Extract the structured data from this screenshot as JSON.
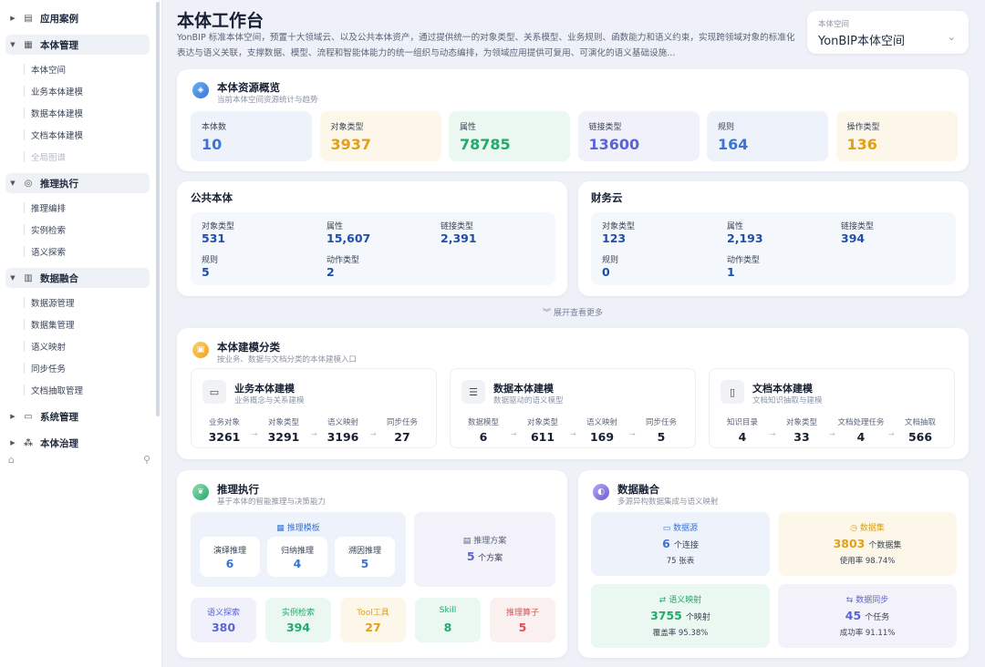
{
  "sidebar": {
    "groups": [
      {
        "label": "应用案例",
        "icon": "apps-icon"
      },
      {
        "label": "本体管理",
        "icon": "ontology-icon"
      },
      {
        "label": "推理执行",
        "icon": "target-icon"
      },
      {
        "label": "数据融合",
        "icon": "bar-chart-icon"
      },
      {
        "label": "系统管理",
        "icon": "monitor-icon"
      },
      {
        "label": "本体治理",
        "icon": "nodes-icon"
      }
    ],
    "ontology_items": [
      "本体空间",
      "业务本体建模",
      "数据本体建模",
      "文档本体建模",
      "全局图谱"
    ],
    "reasoning_items": [
      "推理编排",
      "实例检索",
      "语义探索"
    ],
    "fusion_items": [
      "数据源管理",
      "数据集管理",
      "语义映射",
      "同步任务",
      "文档抽取管理"
    ]
  },
  "header": {
    "title": "本体工作台",
    "desc": "YonBIP 标准本体空间，预置十大领域云、以及公共本体资产，通过提供统一的对象类型、关系模型、业务规则、函数能力和语义约束，实现跨领域对象的标准化表达与语义关联，支撑数据、模型、流程和智能体能力的统一组织与动态编排，为领域应用提供可复用、可演化的语义基础设施...",
    "space_label": "本体空间",
    "space_value": "YonBIP本体空间"
  },
  "overview": {
    "title": "本体资源概览",
    "subtitle": "当前本体空间资源统计与趋势",
    "stats": [
      {
        "label": "本体数",
        "value": "10",
        "color": "#3a74d6",
        "bg": "#eef3fb"
      },
      {
        "label": "对象类型",
        "value": "3937",
        "color": "#e0a019",
        "bg": "#fdf7e9"
      },
      {
        "label": "属性",
        "value": "78785",
        "color": "#24a86c",
        "bg": "#eaf8f1"
      },
      {
        "label": "链接类型",
        "value": "13600",
        "color": "#5b64d6",
        "bg": "#f1f1fb"
      },
      {
        "label": "规则",
        "value": "164",
        "color": "#3a74d6",
        "bg": "#eef3fb"
      },
      {
        "label": "操作类型",
        "value": "136",
        "color": "#e0a019",
        "bg": "#fdf7e9"
      }
    ]
  },
  "public": {
    "title": "公共本体",
    "row1": [
      {
        "label": "对象类型",
        "value": "531"
      },
      {
        "label": "属性",
        "value": "15,607"
      },
      {
        "label": "链接类型",
        "value": "2,391"
      }
    ],
    "row2": [
      {
        "label": "规则",
        "value": "5"
      },
      {
        "label": "动作类型",
        "value": "2"
      }
    ]
  },
  "finance": {
    "title": "财务云",
    "row1": [
      {
        "label": "对象类型",
        "value": "123"
      },
      {
        "label": "属性",
        "value": "2,193"
      },
      {
        "label": "链接类型",
        "value": "394"
      }
    ],
    "row2": [
      {
        "label": "规则",
        "value": "0"
      },
      {
        "label": "动作类型",
        "value": "1"
      }
    ]
  },
  "expand_label": "展开查看更多",
  "modeling": {
    "title": "本体建模分类",
    "subtitle": "按业务、数据与文档分类的本体建模入口",
    "cards": [
      {
        "title": "业务本体建模",
        "subtitle": "业务概念与关系建模",
        "icon": "briefcase-icon",
        "stats": [
          {
            "label": "业务对象",
            "value": "3261"
          },
          {
            "label": "对象类型",
            "value": "3291"
          },
          {
            "label": "语义映射",
            "value": "3196"
          },
          {
            "label": "同步任务",
            "value": "27"
          }
        ]
      },
      {
        "title": "数据本体建模",
        "subtitle": "数据驱动的语义模型",
        "icon": "database-icon",
        "stats": [
          {
            "label": "数据模型",
            "value": "6"
          },
          {
            "label": "对象类型",
            "value": "611"
          },
          {
            "label": "语义映射",
            "value": "169"
          },
          {
            "label": "同步任务",
            "value": "5"
          }
        ]
      },
      {
        "title": "文档本体建模",
        "subtitle": "文档知识抽取与建模",
        "icon": "document-icon",
        "stats": [
          {
            "label": "知识目录",
            "value": "4"
          },
          {
            "label": "对象类型",
            "value": "33"
          },
          {
            "label": "文档处理任务",
            "value": "4"
          },
          {
            "label": "文档抽取",
            "value": "566"
          }
        ]
      }
    ]
  },
  "reasoning": {
    "title": "推理执行",
    "subtitle": "基于本体的智能推理与决策能力",
    "template_label": "推理模板",
    "templates": [
      {
        "label": "演绎推理",
        "value": "6"
      },
      {
        "label": "归纳推理",
        "value": "4"
      },
      {
        "label": "溯因推理",
        "value": "5"
      }
    ],
    "plan_label": "推理方案",
    "plan_value": "5",
    "plan_unit": "个方案",
    "bottom": [
      {
        "label": "语义探索",
        "value": "380",
        "color": "#5b64d6",
        "bg": "#f1f1fb"
      },
      {
        "label": "实例检索",
        "value": "394",
        "color": "#24a86c",
        "bg": "#eaf8f1"
      },
      {
        "label": "Tool工具",
        "value": "27",
        "color": "#e0a019",
        "bg": "#fdf7e9"
      },
      {
        "label": "Skill",
        "value": "8",
        "color": "#24a86c",
        "bg": "#eaf8f1"
      },
      {
        "label": "推理算子",
        "value": "5",
        "color": "#e05050",
        "bg": "#fbf0f0"
      }
    ]
  },
  "fusion": {
    "title": "数据融合",
    "subtitle": "多源异构数据集成与语义映射",
    "boxes": [
      {
        "label": "数据源",
        "value": "6",
        "unit": "个连接",
        "sub": "75 张表",
        "color": "#3a74d6",
        "bg": "#eef3fb"
      },
      {
        "label": "数据集",
        "value": "3803",
        "unit": "个数据集",
        "sub": "使用率 98.74%",
        "color": "#e0a019",
        "bg": "#fdf7e9"
      },
      {
        "label": "语义映射",
        "value": "3755",
        "unit": "个映射",
        "sub": "覆盖率 95.38%",
        "color": "#24a86c",
        "bg": "#eaf8f1"
      },
      {
        "label": "数据同步",
        "value": "45",
        "unit": "个任务",
        "sub": "成功率 91.11%",
        "color": "#5b64d6",
        "bg": "#f3f2fb"
      }
    ]
  }
}
